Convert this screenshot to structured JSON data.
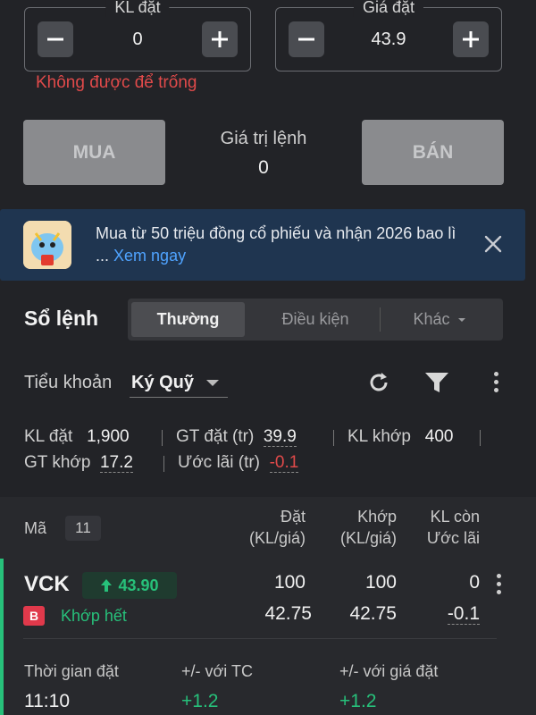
{
  "order_form": {
    "qty": {
      "label": "KL đặt",
      "value": "0"
    },
    "price": {
      "label": "Giá đặt",
      "value": "43.9"
    },
    "error": "Không được để trống",
    "buy_label": "MUA",
    "sell_label": "BÁN",
    "order_value_label": "Giá trị lệnh",
    "order_value": "0"
  },
  "banner": {
    "text": "Mua từ 50 triệu đồng cổ phiếu và nhận 2026 bao lì ...",
    "link": "Xem ngay"
  },
  "order_book": {
    "title": "Sổ lệnh",
    "tabs": [
      "Thường",
      "Điều kiện",
      "Khác"
    ],
    "active_tab": "Thường",
    "subaccount_label": "Tiểu khoản",
    "subaccount_value": "Ký Quỹ",
    "stats": {
      "kl_dat_label": "KL đặt",
      "kl_dat": "1,900",
      "gt_dat_label": "GT đặt (tr)",
      "gt_dat": "39.9",
      "kl_khop_label": "KL khớp",
      "kl_khop": "400",
      "gt_khop_label": "GT khớp",
      "gt_khop": "17.2",
      "uoc_lai_label": "Ước lãi (tr)",
      "uoc_lai": "-0.1"
    },
    "columns": {
      "ma": "Mã",
      "count": "11",
      "dat_1": "Đặt",
      "dat_2": "(KL/giá)",
      "khop_1": "Khớp",
      "khop_2": "(KL/giá)",
      "klcon_1": "KL còn",
      "klcon_2": "Ước lãi"
    },
    "orders": [
      {
        "symbol": "VCK",
        "price": "43.90",
        "side": "B",
        "status": "Khớp hết",
        "dat_qty": "100",
        "dat_price": "42.75",
        "khop_qty": "100",
        "khop_price": "42.75",
        "kl_con": "0",
        "uoc_lai": "-0.1",
        "time_label": "Thời gian đặt",
        "time": "11:10",
        "vs_tc_label": "+/- với TC",
        "vs_tc": "+1.2",
        "vs_price_label": "+/- với giá đặt",
        "vs_price": "+1.2"
      }
    ]
  },
  "colors": {
    "background": "#222327",
    "up": "#27c07a",
    "down": "#e04a4a",
    "link": "#4fa3ff",
    "banner_bg": "#1f3550"
  }
}
